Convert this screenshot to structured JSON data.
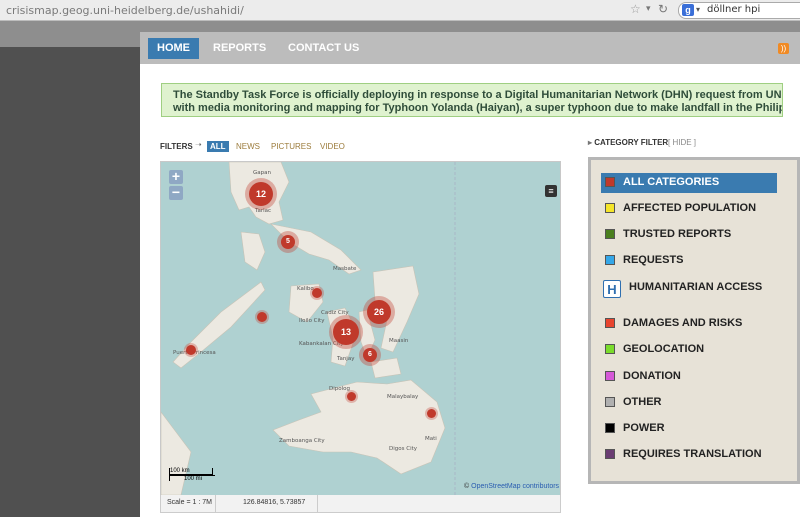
{
  "browser": {
    "url": "crisismap.geog.uni-heidelberg.de/ushahidi/",
    "search_query": "döllner hpi"
  },
  "nav": {
    "items": [
      {
        "label": "HOME",
        "active": true
      },
      {
        "label": "REPORTS",
        "active": false
      },
      {
        "label": "CONTACT US",
        "active": false
      }
    ]
  },
  "banner": {
    "line1": "The Standby Task Force is officially deploying in response to a Digital Humanitarian Network (DHN) request from UN OCHA to assist",
    "line2": "with media monitoring and mapping for Typhoon Yolanda (Haiyan), a super typhoon due to make landfall in the Philippines."
  },
  "filters": {
    "label": "FILTERS",
    "options": [
      "ALL",
      "NEWS",
      "PICTURES",
      "VIDEO"
    ],
    "selected": "ALL"
  },
  "map": {
    "zoom_in": "+",
    "zoom_out": "−",
    "clusters": [
      {
        "count": "12"
      },
      {
        "count": "5"
      },
      {
        "count": "26"
      },
      {
        "count": "13"
      },
      {
        "count": "6"
      }
    ],
    "place_labels": [
      "Gapan",
      "Tarlac",
      "Masbate",
      "Kalibo",
      "Cadiz City",
      "Iloilo City",
      "Kabankalan City",
      "Tanjay",
      "Puerto Princesa",
      "Dipolog",
      "Malaybalay",
      "Zamboanga City",
      "Digos City",
      "Mati",
      "Maasin"
    ],
    "scale_km": "100 km",
    "scale_mi": "100 mi",
    "attribution_prefix": "©",
    "attribution_link": "OpenStreetMap contributors",
    "scale_text": "Scale = 1 : 7M",
    "coordinates": "126.84816, 5.73857"
  },
  "category_filter": {
    "title": "CATEGORY FILTER",
    "hide": "[ HIDE ]",
    "items": [
      {
        "label": "ALL CATEGORIES",
        "color": "#c0392b",
        "active": true
      },
      {
        "label": "AFFECTED POPULATION",
        "color": "#f5e52a"
      },
      {
        "label": "TRUSTED REPORTS",
        "color": "#4a7f1e"
      },
      {
        "label": "REQUESTS",
        "color": "#34a7e8"
      },
      {
        "label": "HUMANITARIAN ACCESS",
        "icon": "H"
      },
      {
        "label": "DAMAGES AND RISKS",
        "color": "#e8452f"
      },
      {
        "label": "GEOLOCATION",
        "color": "#7bdc2c"
      },
      {
        "label": "DONATION",
        "color": "#d65ad8"
      },
      {
        "label": "OTHER",
        "color": "#b0b0b0"
      },
      {
        "label": "POWER",
        "color": "#000000"
      },
      {
        "label": "REQUIRES TRANSLATION",
        "color": "#6a3d72"
      }
    ]
  }
}
